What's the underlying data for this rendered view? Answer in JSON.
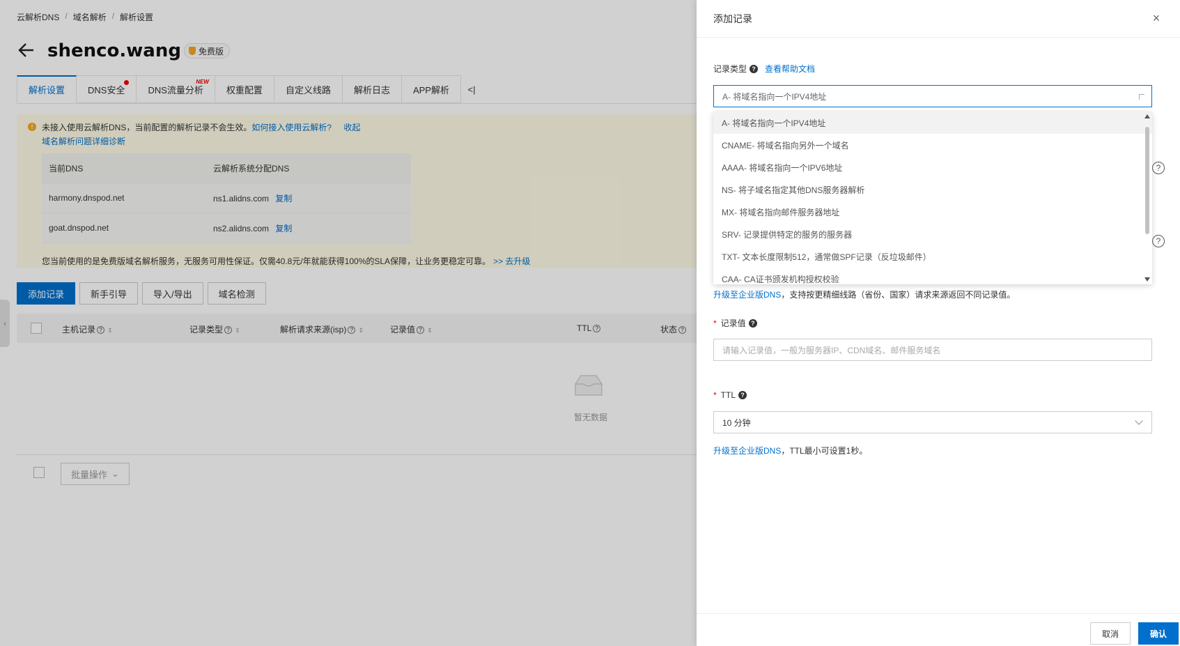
{
  "breadcrumb": [
    "云解析DNS",
    "域名解析",
    "解析设置"
  ],
  "domain": "shenco.wang",
  "badge": "免费版",
  "tabs": [
    {
      "label": "解析设置"
    },
    {
      "label": "DNS安全"
    },
    {
      "label": "DNS流量分析",
      "tag": "NEW"
    },
    {
      "label": "权重配置"
    },
    {
      "label": "自定义线路"
    },
    {
      "label": "解析日志"
    },
    {
      "label": "APP解析"
    }
  ],
  "tab_collapse": "<|",
  "notice": {
    "line1": "未接入使用云解析DNS，当前配置的解析记录不会生效。",
    "line1_link": "如何接入使用云解析?",
    "line1_fold": "收起",
    "line2": "域名解析问题详细诊断",
    "table_head": [
      "当前DNS",
      "云解析系统分配DNS"
    ],
    "rows": [
      {
        "current": "harmony.dnspod.net",
        "assigned": "ns1.alidns.com",
        "copy": "复制"
      },
      {
        "current": "goat.dnspod.net",
        "assigned": "ns2.alidns.com",
        "copy": "复制"
      }
    ],
    "line3": "您当前使用的是免费版域名解析服务，无服务可用性保证。仅需40.8元/年就能获得100%的SLA保障，让业务更稳定可靠。",
    "line3_link": ">> 去升级"
  },
  "actions": [
    "添加记录",
    "新手引导",
    "导入/导出",
    "域名检测"
  ],
  "grid_head": [
    "主机记录",
    "记录类型",
    "解析请求来源(isp)",
    "记录值",
    "TTL",
    "状态"
  ],
  "empty_text": "暂无数据",
  "batch": "批量操作",
  "drawer": {
    "title": "添加记录",
    "record_type_label": "记录类型",
    "help_link": "查看帮助文档",
    "record_type_value": "A- 将域名指向一个IPV4地址",
    "options": [
      "A- 将域名指向一个IPV4地址",
      "CNAME- 将域名指向另外一个域名",
      "AAAA- 将域名指向一个IPV6地址",
      "NS- 将子域名指定其他DNS服务器解析",
      "MX- 将域名指向邮件服务器地址",
      "SRV- 记录提供特定的服务的服务器",
      "TXT- 文本长度限制512，通常做SPF记录（反垃圾邮件）",
      "CAA- CA证书颁发机构授权校验"
    ],
    "upgrade_link": "升级至企业版DNS",
    "upgrade_hint": "，支持按更精细线路（省份、国家）请求来源返回不同记录值。",
    "record_value_label": "记录值",
    "record_value_placeholder": "请输入记录值，一般为服务器IP、CDN域名、邮件服务域名",
    "ttl_label": "TTL",
    "ttl_value": "10 分钟",
    "ttl_hint": "，TTL最小可设置1秒。",
    "cancel": "取消",
    "confirm": "确认"
  },
  "colors": {
    "primary": "#0070cc",
    "required": "#e00000",
    "notice_bg": "#fffbe6"
  }
}
